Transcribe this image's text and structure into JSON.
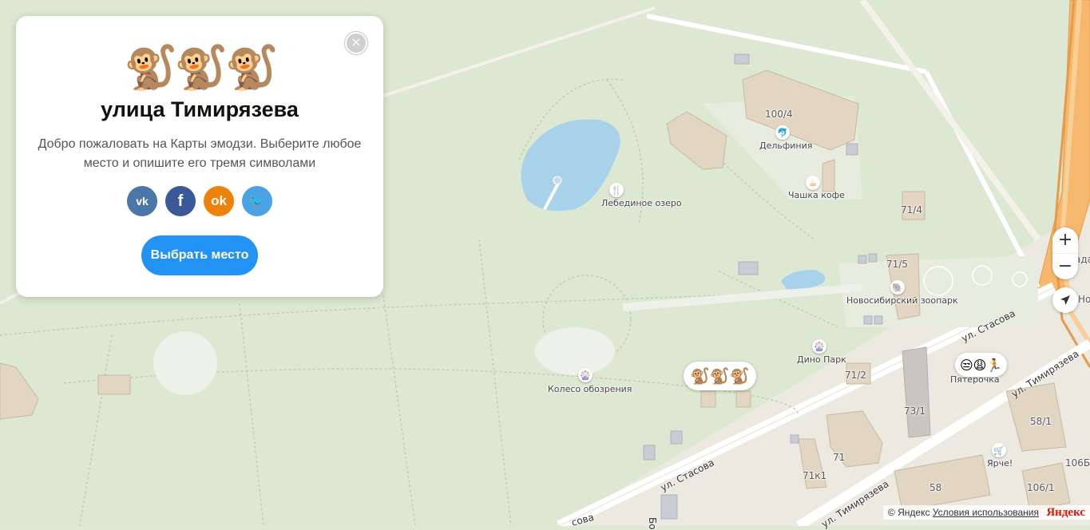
{
  "card": {
    "emojis": "🐒🐒🐒",
    "title": "улица Тимирязева",
    "description": "Добро пожаловать на Карты эмодзи. Выберите любое место и опишите его тремя символами",
    "social": {
      "vk": "vk",
      "fb": "f",
      "ok": "ok",
      "tw": "🐦"
    },
    "choose_button": "Выбрать место",
    "close": "×"
  },
  "map": {
    "labels": {
      "lake": "Лебединое озеро",
      "dolphinarium": "Дельфиния",
      "cafe": "Чашка кофе",
      "zoo": "Новосибирский зоопарк",
      "dino": "Дино Парк",
      "wheel": "Колесо обозрения",
      "pyaterochka": "Пятерочка",
      "yarche": "Ярче!",
      "b100_4": "100/4",
      "b71_4": "71/4",
      "b71_5": "71/5",
      "b71_2": "71/2",
      "b73_1": "73/1",
      "b58_1": "58/1",
      "b71": "71",
      "b71k1": "71к1",
      "b58": "58",
      "b106_1": "106/1",
      "b106b": "106Б",
      "edge_ho": "Но",
      "edge_ada": "ада",
      "bo": "Бо",
      "sova": "сова"
    },
    "streets": {
      "stasova1": "ул. Стасова",
      "stasova2": "ул. Стасова",
      "timiryazeva1": "ул. Тимирязева",
      "timiryazeva2": "ул. Тимирязева"
    },
    "bubbles": {
      "monkeys": "🐒🐒🐒",
      "faces": "😒😩🏃"
    }
  },
  "controls": {
    "zoom_in": "+",
    "zoom_out": "−"
  },
  "footer": {
    "copyright": "© Яндекс",
    "terms": "Условия использования",
    "logo": "Яндекс"
  }
}
